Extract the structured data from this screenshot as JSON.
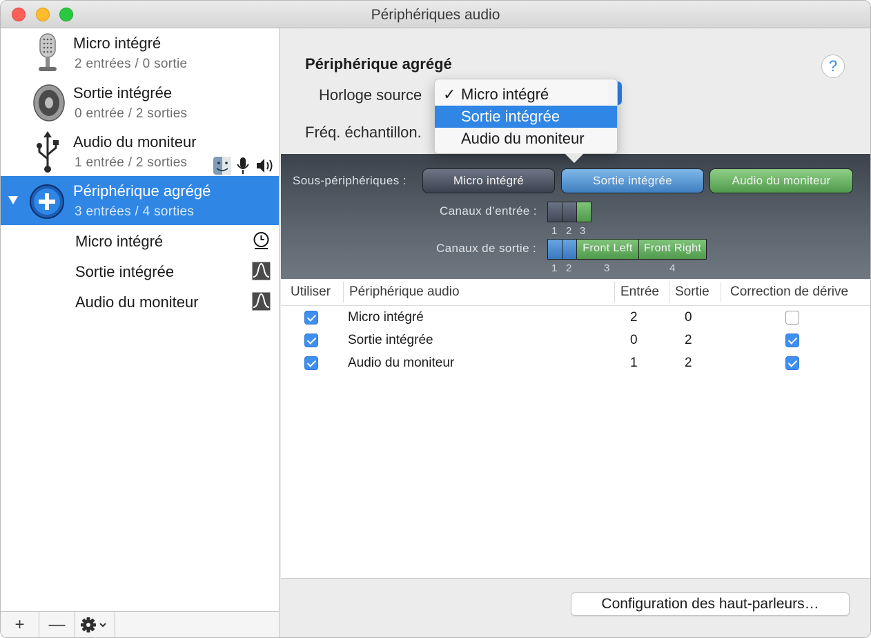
{
  "window": {
    "title": "Périphériques audio"
  },
  "sidebar": {
    "devices": [
      {
        "name": "Micro intégré",
        "io": "2 entrées / 0 sortie",
        "icon": "microphone-icon"
      },
      {
        "name": "Sortie intégrée",
        "io": "0 entrée / 2 sorties",
        "icon": "speaker-icon"
      },
      {
        "name": "Audio du moniteur",
        "io": "1 entrée / 2 sorties",
        "icon": "usb-icon"
      },
      {
        "name": "Périphérique agrégé",
        "io": "3 entrées / 4 sorties",
        "icon": "aggregate-plus-icon"
      }
    ],
    "subdevices": [
      {
        "name": "Micro intégré",
        "icon": "clock-icon"
      },
      {
        "name": "Sortie intégrée",
        "icon": "waveform-icon"
      },
      {
        "name": "Audio du moniteur",
        "icon": "waveform-icon"
      }
    ],
    "bottom": {
      "add": "+",
      "remove": "—"
    }
  },
  "panel": {
    "title": "Périphérique agrégé",
    "help": "?",
    "clock_label": "Horloge source",
    "rate_label": "Fréq. échantillon.",
    "clock_menu": [
      {
        "check": "✓",
        "label": "Micro intégré"
      },
      {
        "check": "",
        "label": "Sortie intégrée"
      },
      {
        "check": "",
        "label": "Audio du moniteur"
      }
    ],
    "subdevices_label": "Sous-périphériques :",
    "subdevice_pills": [
      "Micro intégré",
      "Sortie intégrée",
      "Audio du moniteur"
    ],
    "input_channels_label": "Canaux d’entrée :",
    "input_channel_numbers": [
      "1",
      "2",
      "3"
    ],
    "output_channels_label": "Canaux de sortie :",
    "output_channel_numbers": [
      "1",
      "2",
      "3",
      "4"
    ],
    "output_channel_names": [
      "Front Left",
      "Front Right"
    ],
    "speaker_button": "Configuration des haut-parleurs…"
  },
  "table": {
    "headers": [
      "Utiliser",
      "Périphérique audio",
      "Entrée",
      "Sortie",
      "Correction de dérive"
    ],
    "rows": [
      {
        "use": true,
        "device": "Micro intégré",
        "in": "2",
        "out": "0",
        "drift": false
      },
      {
        "use": true,
        "device": "Sortie intégrée",
        "in": "0",
        "out": "2",
        "drift": true
      },
      {
        "use": true,
        "device": "Audio du moniteur",
        "in": "1",
        "out": "2",
        "drift": true
      }
    ]
  },
  "colors": {
    "selection": "#2f86e4",
    "checkbox": "#3e8ff0",
    "pill_green": "#4f9a4c",
    "pill_blue": "#3f7fc0"
  }
}
